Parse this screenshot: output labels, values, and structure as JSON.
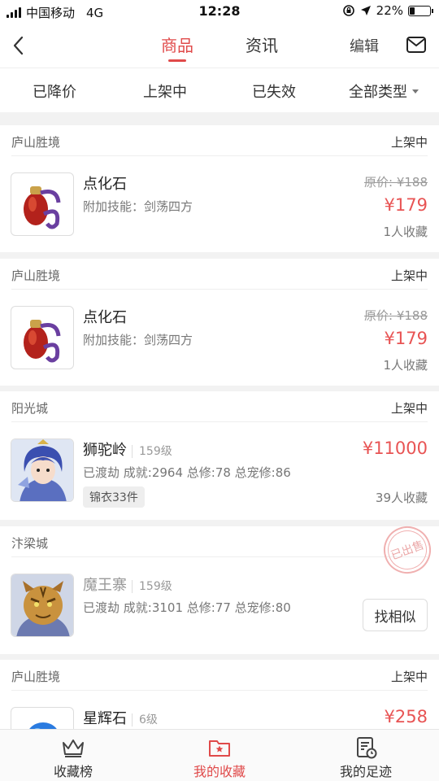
{
  "status_bar": {
    "carrier": "中国移动",
    "network": "4G",
    "time": "12:28",
    "battery": "22%",
    "battery_level": 0.22
  },
  "nav": {
    "tabs": [
      {
        "label": "商品",
        "active": true
      },
      {
        "label": "资讯",
        "active": false
      }
    ],
    "edit_label": "编辑",
    "icons": {
      "back": "chevron-left-icon",
      "mail": "mail-icon"
    },
    "accent_color": "#e04a4a"
  },
  "filters": [
    {
      "label": "已降价"
    },
    {
      "label": "上架中"
    },
    {
      "label": "已失效"
    },
    {
      "label": "全部类型",
      "dropdown": true
    }
  ],
  "items": [
    {
      "location": "庐山胜境",
      "status": "上架中",
      "name": "点化石",
      "subtitle": "附加技能：剑荡四方",
      "original_price": "原价: ¥188",
      "price": "¥179",
      "favorites": "1人收藏",
      "thumb": "gourd-icon"
    },
    {
      "location": "庐山胜境",
      "status": "上架中",
      "name": "点化石",
      "subtitle": "附加技能：剑荡四方",
      "original_price": "原价: ¥188",
      "price": "¥179",
      "favorites": "1人收藏",
      "thumb": "gourd-icon"
    },
    {
      "location": "阳光城",
      "status": "上架中",
      "name": "狮驼岭",
      "level": "159级",
      "subtitle": "已渡劫 成就:2964 总修:78 总宠修:86",
      "tag": "锦衣33件",
      "price": "¥11000",
      "favorites": "39人收藏",
      "thumb": "warrior-avatar"
    },
    {
      "location": "汴梁城",
      "status_stamp": "已出售",
      "name": "魔王寨",
      "level": "159级",
      "subtitle": "已渡劫 成就:3101 总修:77 总宠修:80",
      "action_label": "找相似",
      "thumb": "tiger-avatar"
    },
    {
      "location": "庐山胜境",
      "status": "上架中",
      "name": "星辉石",
      "level": "6级",
      "price": "¥258",
      "thumb": "gem-icon"
    }
  ],
  "bottom_tabs": [
    {
      "label": "收藏榜",
      "icon": "crown-icon",
      "active": false
    },
    {
      "label": "我的收藏",
      "icon": "favorites-folder-icon",
      "active": true
    },
    {
      "label": "我的足迹",
      "icon": "history-icon",
      "active": false
    }
  ]
}
